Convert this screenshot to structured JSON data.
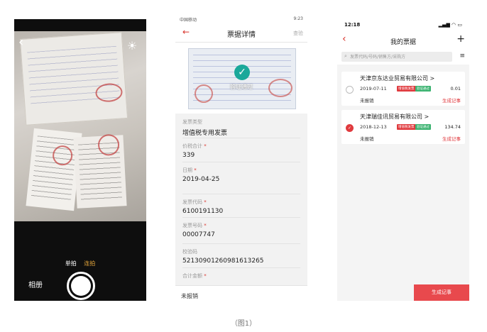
{
  "panel_camera": {
    "modes": [
      "单拍",
      "连拍"
    ],
    "album_label": "相册"
  },
  "panel_detail": {
    "status_left": "中国移动",
    "status_right": "9:23",
    "title": "票据详情",
    "action": "查验",
    "verified_label": "验证通过",
    "fields": [
      {
        "label": "发票类型",
        "required": false,
        "value": "增值税专用发票"
      },
      {
        "label": "价税合计",
        "required": true,
        "value": "339"
      },
      {
        "label": "日期",
        "required": true,
        "value": "2019-04-25"
      },
      {
        "label": "发票代码",
        "required": true,
        "value": "6100191130"
      },
      {
        "label": "发票号码",
        "required": true,
        "value": "00007747"
      },
      {
        "label": "校验码",
        "required": false,
        "value": "52130901260981613265"
      },
      {
        "label": "合计金额",
        "required": true,
        "value": ""
      }
    ],
    "bottom_status": "未报销"
  },
  "panel_list": {
    "time": "12:18",
    "title": "我的票据",
    "search_placeholder": "发票代码/号码/销售方/采购方",
    "items": [
      {
        "company": "天津京东达业贸易有限公司 >",
        "date": "2019-07-11",
        "badges": [
          "增值税发票",
          "验证通过"
        ],
        "amount": "0.01",
        "status": "未报销",
        "action": "生成记事",
        "selected": false
      },
      {
        "company": "天津瑞佳讯贸易有限公司 >",
        "date": "2018-12-13",
        "badges": [
          "增值税发票",
          "验证通过"
        ],
        "amount": "134.74",
        "status": "未报销",
        "action": "生成记事",
        "selected": true
      }
    ],
    "bottom_button": "生成记事"
  },
  "caption": "（图1）"
}
